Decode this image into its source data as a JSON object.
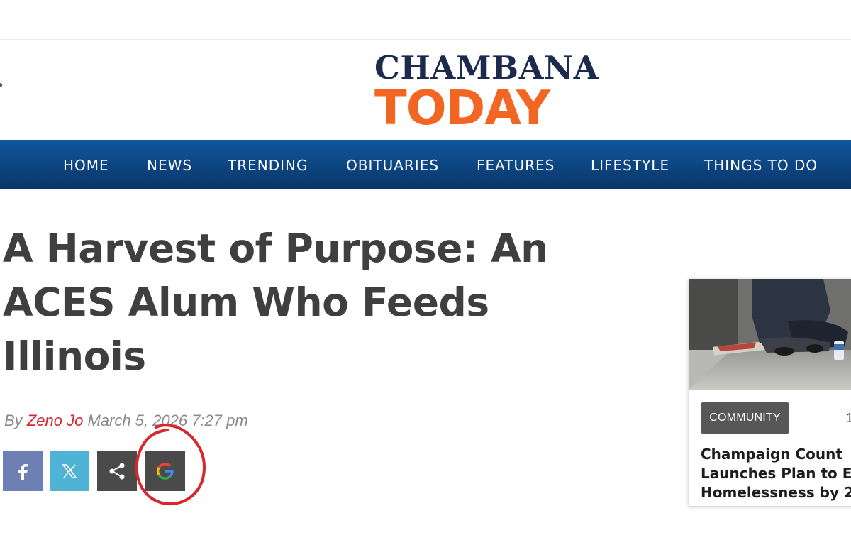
{
  "site": {
    "logo_top": "CHAMBANA",
    "logo_bottom": "TODAY"
  },
  "nav": {
    "items": [
      "HOME",
      "NEWS",
      "TRENDING",
      "OBITUARIES",
      "FEATURES",
      "LIFESTYLE",
      "THINGS TO DO"
    ]
  },
  "article": {
    "title_lines": [
      "A Harvest of Purpose: An",
      "ACES Alum Who Feeds",
      "Illinois"
    ],
    "by_prefix": "By",
    "author": "Zeno Jo",
    "date": "March 5, 2026 7:27 pm"
  },
  "share": {
    "facebook_icon": "facebook-icon",
    "x_icon": "x-icon",
    "share_icon": "share-icon",
    "google_icon": "google-icon"
  },
  "sidebar_card": {
    "badge": "COMMUNITY",
    "number": "1",
    "title_lines": [
      "Champaign Count",
      "Launches Plan to E",
      "Homelessness by 2"
    ]
  },
  "colors": {
    "brand_navy": "#1c2b4d",
    "brand_orange": "#f26522",
    "nav_blue": "#0c3f78",
    "author_red": "#d9252d",
    "annotation_red": "#d9252d"
  }
}
